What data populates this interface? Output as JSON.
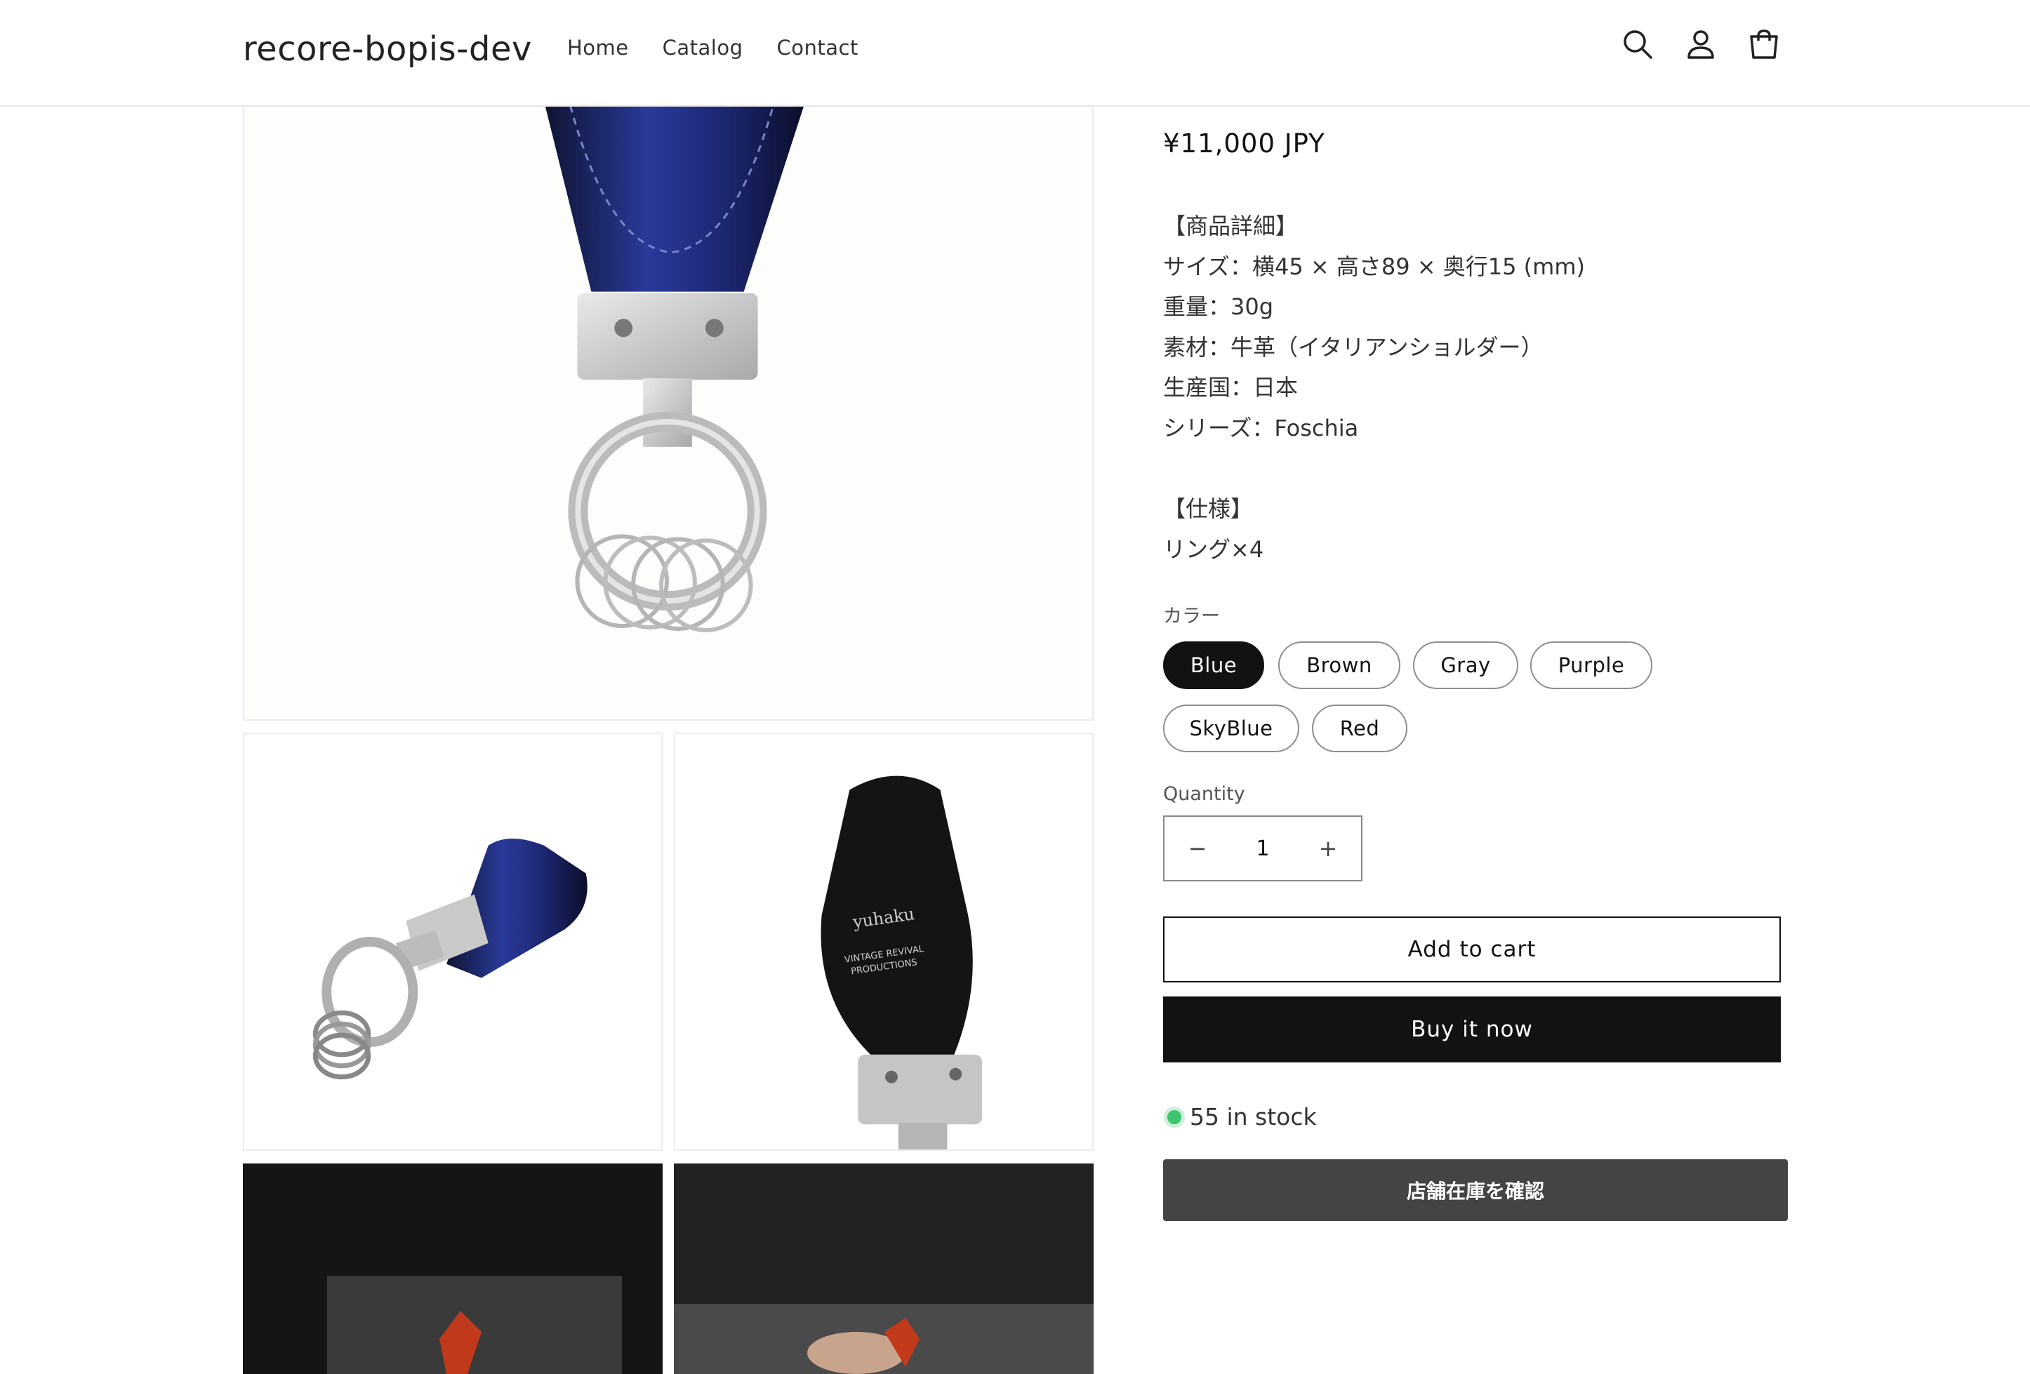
{
  "header": {
    "logo": "recore-bopis-dev",
    "nav": [
      "Home",
      "Catalog",
      "Contact"
    ],
    "icons": [
      "search-icon",
      "account-icon",
      "cart-icon"
    ]
  },
  "product": {
    "price": "¥11,000 JPY",
    "description_lines": [
      "【商品詳細】",
      "サイズ：横45 × 高さ89 × 奥行15 (mm)",
      "重量：30g",
      "素材：牛革（イタリアンショルダー）",
      "生産国：日本",
      "シリーズ：Foschia",
      "",
      "【仕様】",
      "リング×4"
    ],
    "option_label": "カラー",
    "colors": [
      "Blue",
      "Brown",
      "Gray",
      "Purple",
      "SkyBlue",
      "Red"
    ],
    "selected_color": "Blue",
    "quantity_label": "Quantity",
    "quantity": "1",
    "minus_symbol": "−",
    "plus_symbol": "+",
    "add_to_cart": "Add to cart",
    "buy_now": "Buy it now",
    "stock": "55 in stock",
    "store_stock_button": "店舗在庫を確認"
  },
  "gallery": {
    "stamp_brand": "yuhaku",
    "stamp_line1": "VINTAGE REVIVAL",
    "stamp_line2": "PRODUCTIONS"
  },
  "colors": {
    "accent": "#121212",
    "stock_green": "#3ec46d",
    "store_button": "#444444",
    "leather_blue": "#1e2a6b"
  }
}
